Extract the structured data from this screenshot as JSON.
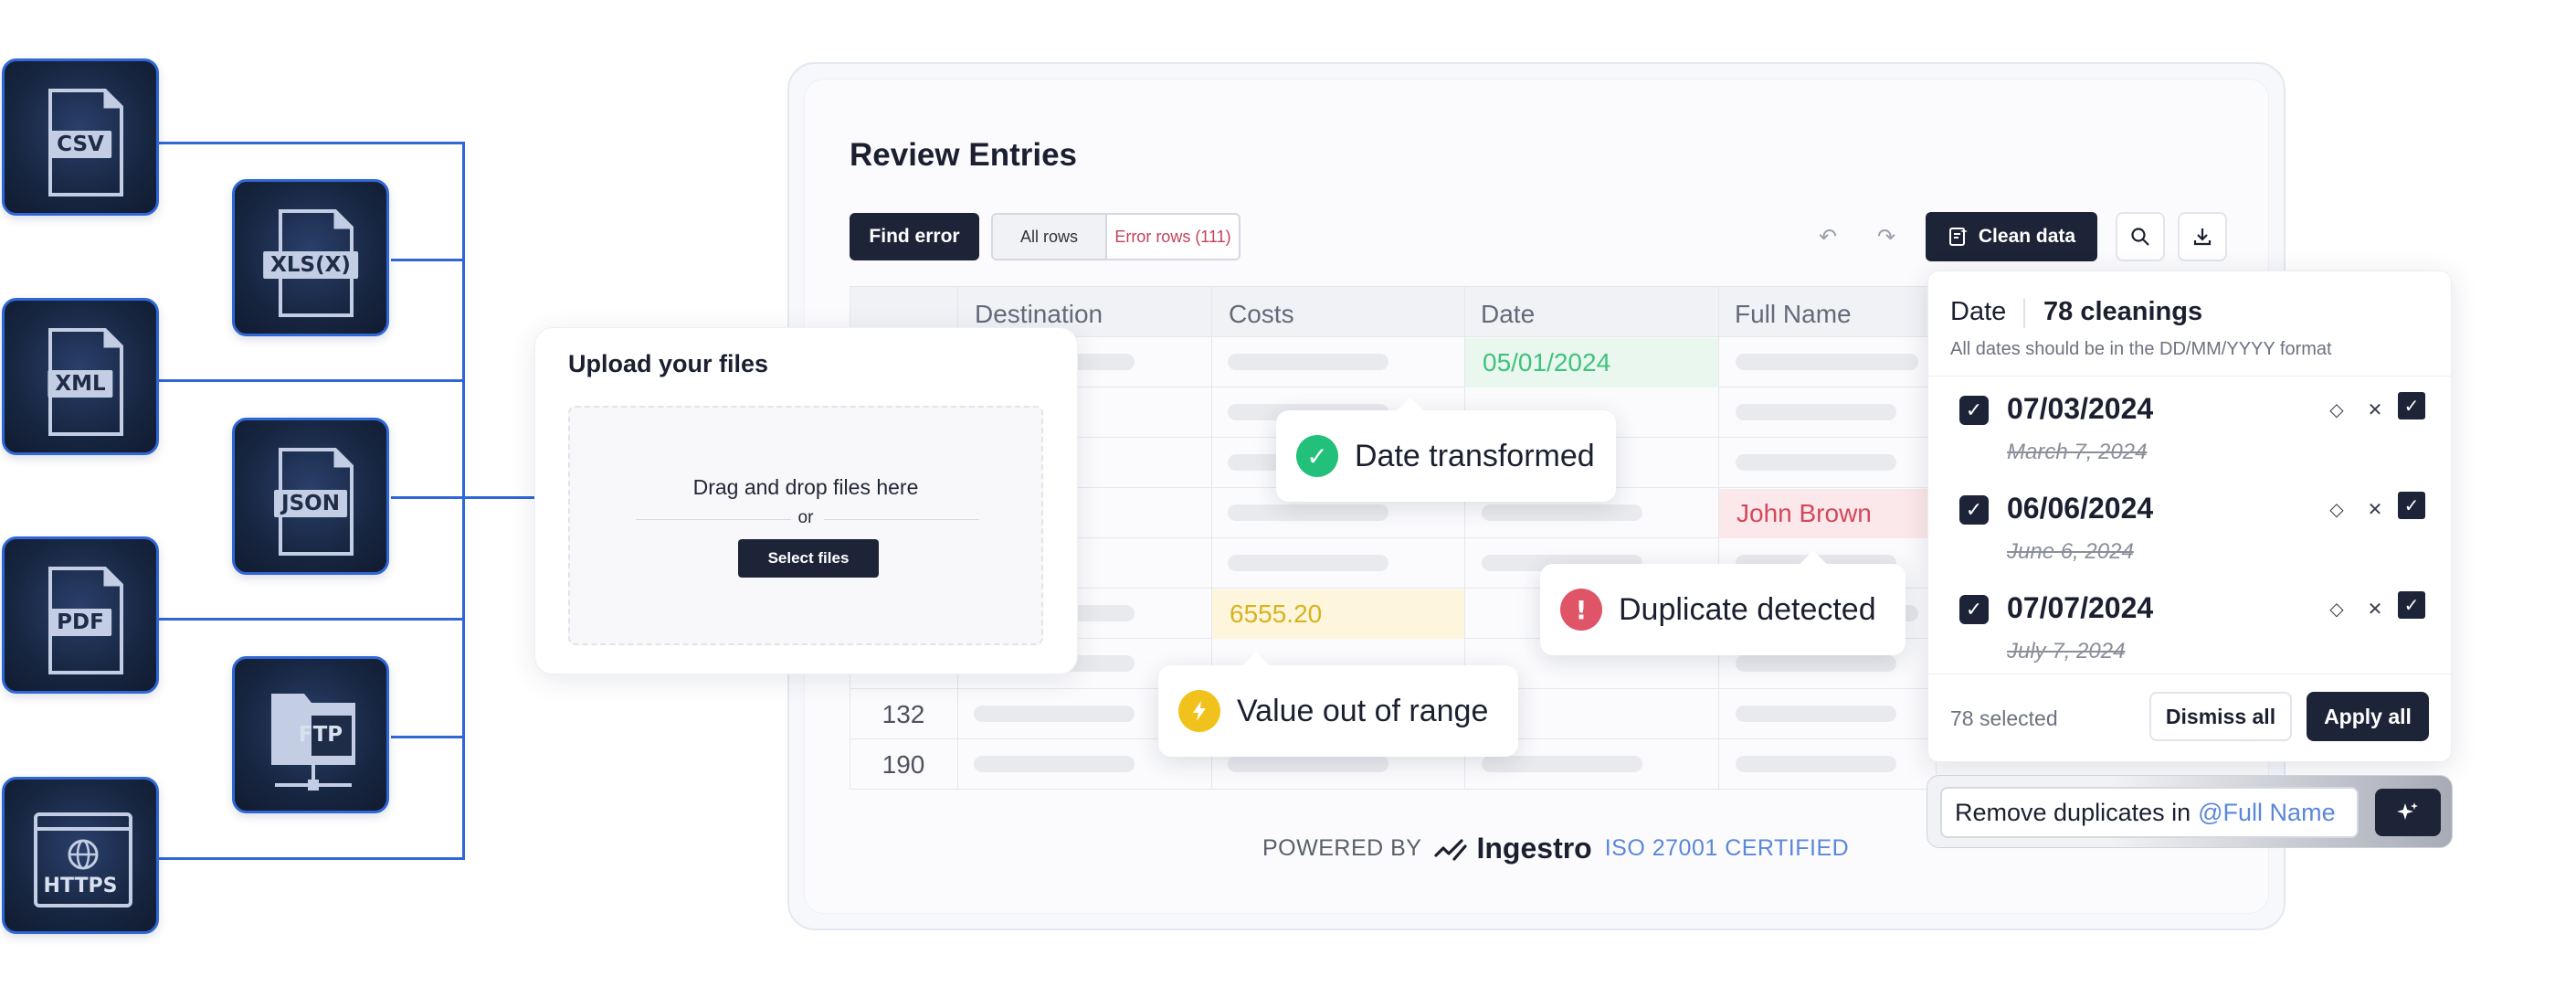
{
  "sources": {
    "csv": "CSV",
    "xls": "XLS(X)",
    "xml": "XML",
    "json": "JSON",
    "pdf": "PDF",
    "ftp": "FTP",
    "https": "HTTPS"
  },
  "review": {
    "title": "Review Entries",
    "find_error": "Find error",
    "all_rows": "All rows",
    "error_rows": "Error rows (111)",
    "clean_data": "Clean data"
  },
  "table": {
    "columns": [
      "Destination",
      "Costs",
      "Date",
      "Full Name"
    ],
    "highlight_date": "05/01/2024",
    "highlight_name": "John Brown",
    "highlight_cost": "6555.20",
    "row_ids": [
      "132",
      "190"
    ]
  },
  "upload": {
    "title": "Upload your files",
    "drag_text": "Drag and drop files here",
    "or": "or",
    "select_files": "Select files"
  },
  "toasts": {
    "date_transformed": "Date transformed",
    "duplicate_detected": "Duplicate detected",
    "value_out_of_range": "Value out of range"
  },
  "panel": {
    "column": "Date",
    "count": "78 cleanings",
    "subtitle": "All dates should be in the DD/MM/YYYY format",
    "entries": [
      {
        "new": "07/03/2024",
        "old": "March 7, 2024"
      },
      {
        "new": "06/06/2024",
        "old": "June 6, 2024"
      },
      {
        "new": "07/07/2024",
        "old": "July 7, 2024"
      }
    ],
    "selected": "78 selected",
    "dismiss_all": "Dismiss all",
    "apply_all": "Apply all"
  },
  "command": {
    "text": "Remove duplicates in",
    "mention": "@Full Name"
  },
  "footer": {
    "powered_by": "POWERED BY",
    "brand": "Ingestro",
    "iso": "ISO 27001 CERTIFIED"
  },
  "colors": {
    "accent_blue": "#2f67d6",
    "dark": "#1d2438",
    "success": "#22c07a",
    "error": "#e05468",
    "warning": "#f2c21c"
  }
}
